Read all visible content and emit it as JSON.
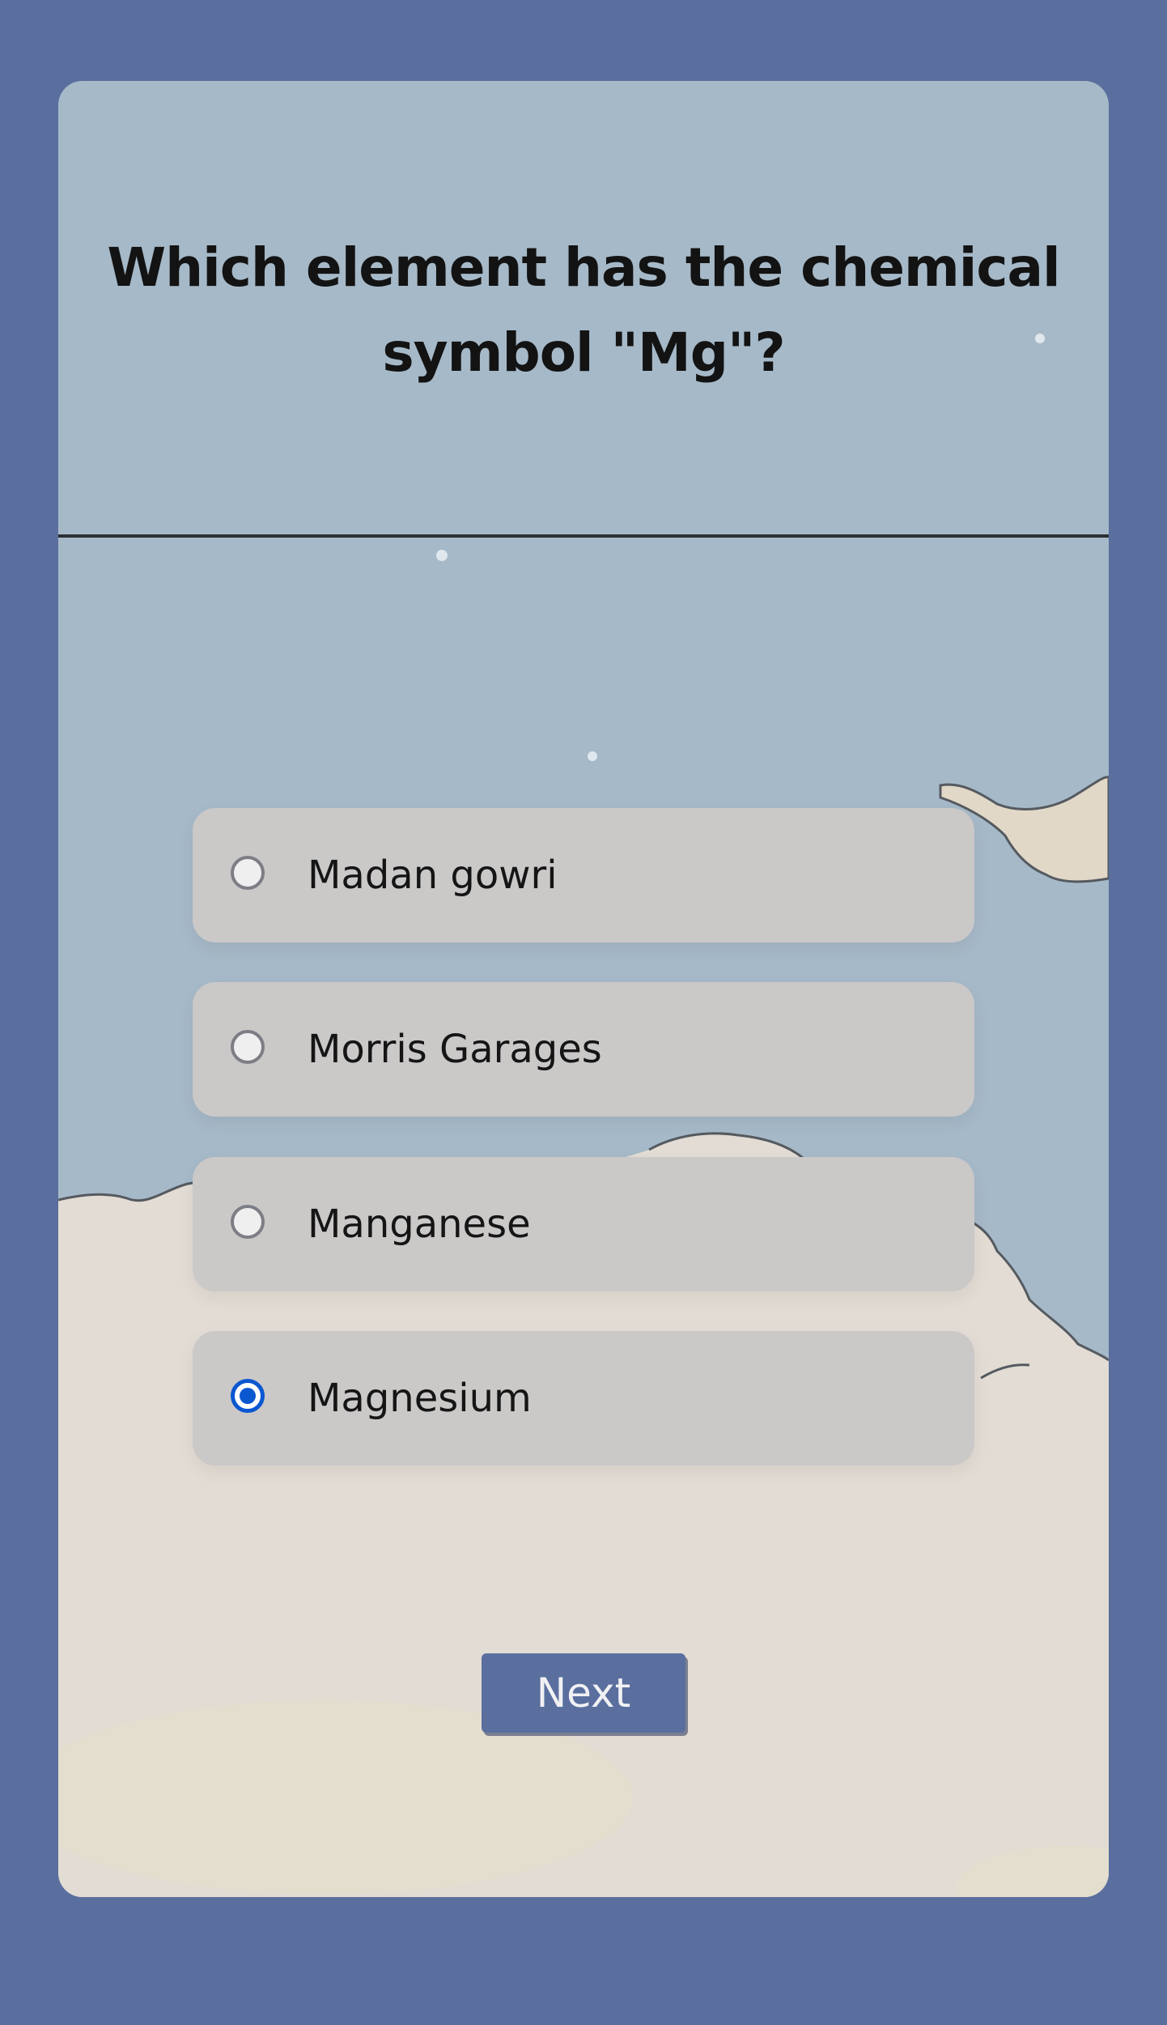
{
  "quiz": {
    "question": "Which element has the chemical symbol \"Mg\"?",
    "options": [
      {
        "label": "Madan gowri",
        "selected": false
      },
      {
        "label": "Morris Garages",
        "selected": false
      },
      {
        "label": "Manganese",
        "selected": false
      },
      {
        "label": "Magnesium",
        "selected": true
      }
    ],
    "next_label": "Next"
  },
  "colors": {
    "page_background": "#5a6f9e",
    "sky": "#a6b9c8",
    "cloud": "#e2dcd4",
    "option_background": "#cbc8c8",
    "radio_checked": "#0b57d0",
    "button_background": "#5a6f9e"
  }
}
